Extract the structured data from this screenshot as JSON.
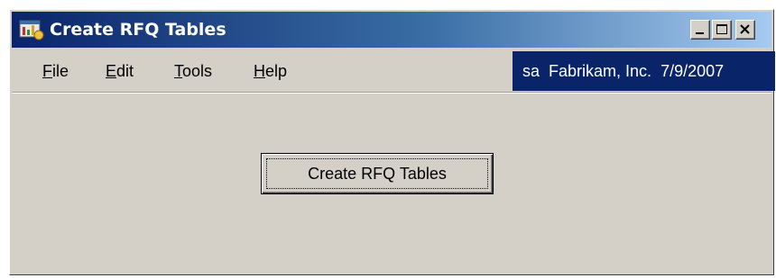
{
  "window": {
    "title": "Create RFQ Tables",
    "icon": "dynamics-app-icon",
    "controls": {
      "minimize": "minimize-icon",
      "maximize": "maximize-icon",
      "close": "close-icon"
    }
  },
  "menu": {
    "items": [
      {
        "label": "File",
        "accel": "F",
        "rest": "ile"
      },
      {
        "label": "Edit",
        "accel": "E",
        "rest": "dit"
      },
      {
        "label": "Tools",
        "accel": "T",
        "rest": "ools"
      },
      {
        "label": "Help",
        "accel": "H",
        "rest": "elp"
      }
    ]
  },
  "status": {
    "user": "sa",
    "company": "Fabrikam, Inc.",
    "date": "7/9/2007"
  },
  "main": {
    "button_label": "Create RFQ Tables"
  },
  "colors": {
    "face": "#d4d0c8",
    "titlebar_start": "#0a246a",
    "titlebar_end": "#a6caf0",
    "status_panel": "#0a246a"
  }
}
